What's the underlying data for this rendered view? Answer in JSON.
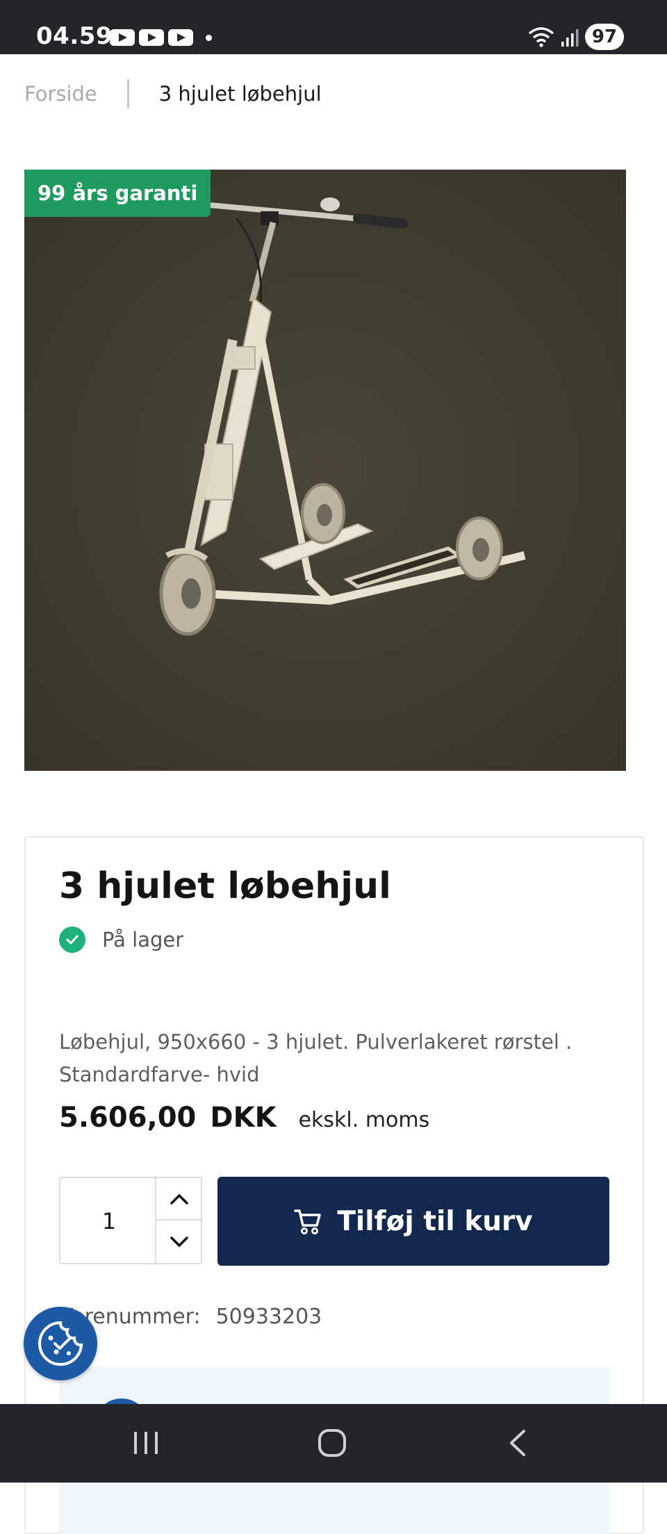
{
  "status_bar": {
    "time": "04.59",
    "battery": "97"
  },
  "breadcrumb": {
    "home": "Forside",
    "current": "3 hjulet løbehjul"
  },
  "product": {
    "badge": "99 års garanti",
    "title": "3 hjulet løbehjul",
    "stock": "På lager",
    "description": "Løbehjul, 950x660 - 3 hjulet. Pulverlakeret rørstel . Standardfarve- hvid",
    "price": "5.606,00",
    "currency": "DKK",
    "price_note": "ekskl. moms",
    "quantity": "1",
    "add_to_cart": "Tilføj til kurv",
    "sku_label": "Varenummer:",
    "sku_value": "50933203"
  },
  "colors": {
    "accent": "#12284d",
    "badge": "#1e9a5e",
    "stock": "#1eb27a",
    "cookie": "#1d5aa6"
  }
}
